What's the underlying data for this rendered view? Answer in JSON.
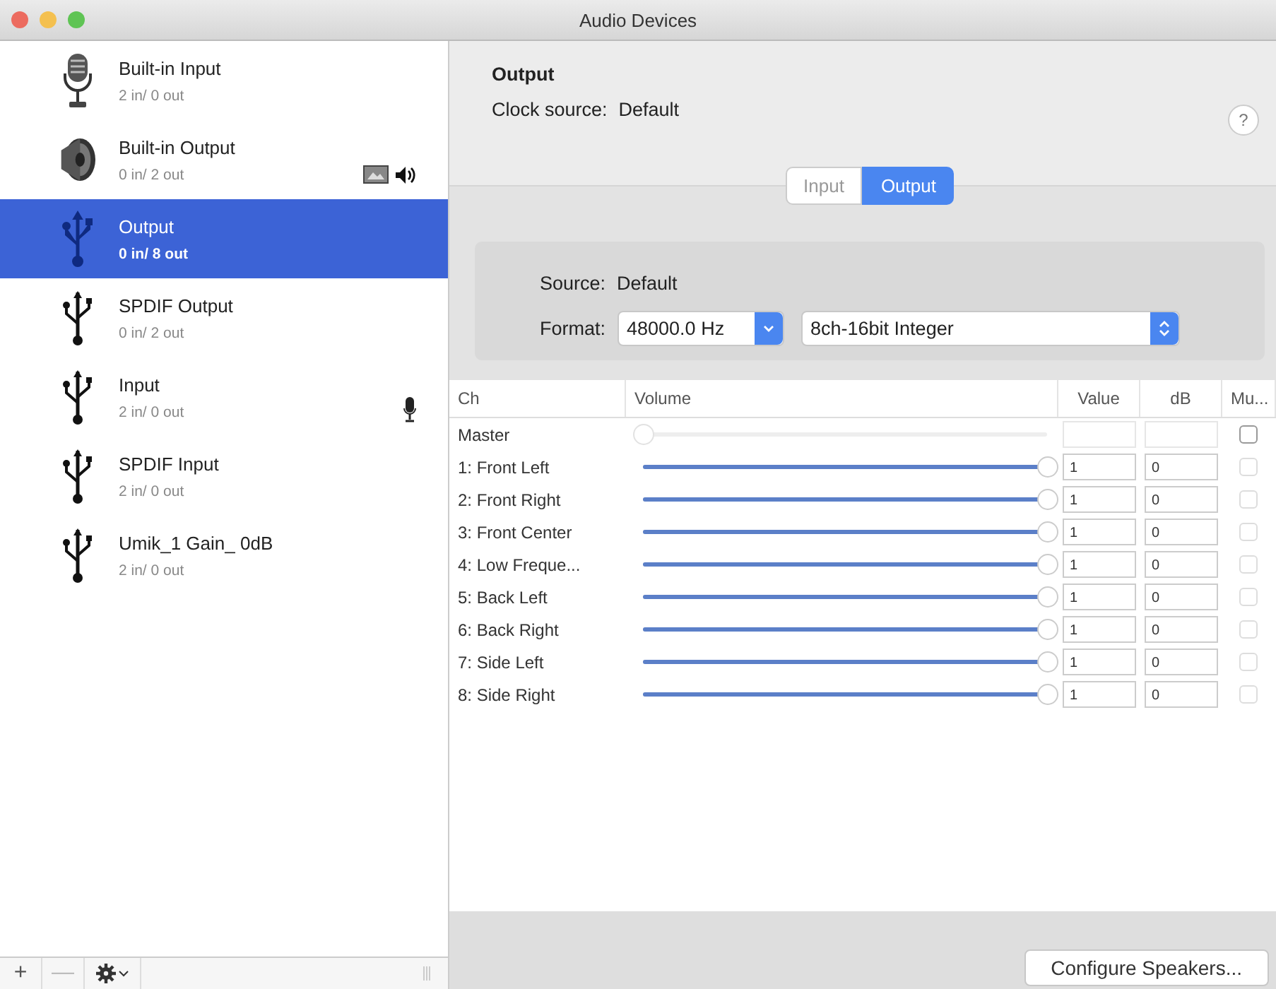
{
  "window": {
    "title": "Audio Devices"
  },
  "devices": [
    {
      "name": "Built-in Input",
      "io": "2 in/ 0 out",
      "kind": "mic",
      "selected": false,
      "system_output": false,
      "default_output": false,
      "default_input": false
    },
    {
      "name": "Built-in Output",
      "io": "0 in/ 2 out",
      "kind": "speaker",
      "selected": false,
      "system_output": true,
      "default_output": true,
      "default_input": false
    },
    {
      "name": "Output",
      "io": "0 in/ 8 out",
      "kind": "usb",
      "selected": true,
      "system_output": false,
      "default_output": false,
      "default_input": false
    },
    {
      "name": "SPDIF Output",
      "io": "0 in/ 2 out",
      "kind": "usb",
      "selected": false,
      "system_output": false,
      "default_output": false,
      "default_input": false
    },
    {
      "name": "Input",
      "io": "2 in/ 0 out",
      "kind": "usb",
      "selected": false,
      "system_output": false,
      "default_output": false,
      "default_input": true
    },
    {
      "name": "SPDIF Input",
      "io": "2 in/ 0 out",
      "kind": "usb",
      "selected": false,
      "system_output": false,
      "default_output": false,
      "default_input": false
    },
    {
      "name": "Umik_1  Gain_  0dB",
      "io": "2 in/ 0 out",
      "kind": "usb",
      "selected": false,
      "system_output": false,
      "default_output": false,
      "default_input": false
    }
  ],
  "toolbar": {
    "add": "+",
    "remove": "—"
  },
  "detail": {
    "title": "Output",
    "clock_label": "Clock source:",
    "clock_value": "Default",
    "help": "?",
    "tabs": [
      {
        "label": "Input",
        "selected": false
      },
      {
        "label": "Output",
        "selected": true
      }
    ],
    "source_label": "Source:",
    "source_value": "Default",
    "format_label": "Format:",
    "rate": "48000.0 Hz",
    "format": "8ch-16bit Integer"
  },
  "table": {
    "columns": [
      "Ch",
      "Volume",
      "Value",
      "dB",
      "Mu..."
    ],
    "rows": [
      {
        "kind": "master",
        "name": "Master",
        "level": 0,
        "value": "",
        "db": "",
        "muted": false,
        "disabled": false
      },
      {
        "kind": "channel",
        "name": "1: Front Left",
        "level": 1,
        "value": "1",
        "db": "0",
        "muted": false,
        "disabled": true
      },
      {
        "kind": "channel",
        "name": "2: Front Right",
        "level": 1,
        "value": "1",
        "db": "0",
        "muted": false,
        "disabled": true
      },
      {
        "kind": "channel",
        "name": "3: Front Center",
        "level": 1,
        "value": "1",
        "db": "0",
        "muted": false,
        "disabled": true
      },
      {
        "kind": "channel",
        "name": "4: Low Freque...",
        "level": 1,
        "value": "1",
        "db": "0",
        "muted": false,
        "disabled": true
      },
      {
        "kind": "channel",
        "name": "5: Back Left",
        "level": 1,
        "value": "1",
        "db": "0",
        "muted": false,
        "disabled": true
      },
      {
        "kind": "channel",
        "name": "6: Back Right",
        "level": 1,
        "value": "1",
        "db": "0",
        "muted": false,
        "disabled": true
      },
      {
        "kind": "channel",
        "name": "7: Side Left",
        "level": 1,
        "value": "1",
        "db": "0",
        "muted": false,
        "disabled": true
      },
      {
        "kind": "channel",
        "name": "8: Side Right",
        "level": 1,
        "value": "1",
        "db": "0",
        "muted": false,
        "disabled": true
      }
    ]
  },
  "configure_button": "Configure Speakers..."
}
